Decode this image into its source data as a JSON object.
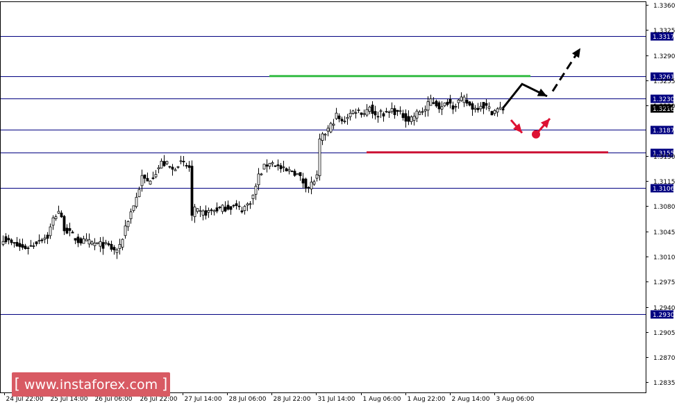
{
  "chart_data": {
    "type": "candlestick",
    "instrument_view": "price chart",
    "y_axis": {
      "range": [
        1.2821,
        1.3364
      ],
      "ticks": [
        "1.3360",
        "1.3325",
        "1.3290",
        "1.3255",
        "1.3220",
        "1.3150",
        "1.3115",
        "1.3080",
        "1.3045",
        "1.3010",
        "1.2975",
        "1.2940",
        "1.2905",
        "1.2870",
        "1.2835"
      ]
    },
    "x_axis": {
      "ticks": [
        "24 Jul 22:00",
        "25 Jul 14:00",
        "26 Jul 06:00",
        "26 Jul 22:00",
        "27 Jul 14:00",
        "28 Jul 06:00",
        "28 Jul 22:00",
        "31 Jul 14:00",
        "1 Aug 06:00",
        "1 Aug 22:00",
        "2 Aug 14:00",
        "3 Aug 06:00"
      ]
    },
    "horizontal_levels": [
      {
        "label": "1.3317",
        "value": 1.3317,
        "color": "#000080"
      },
      {
        "label": "1.3261",
        "value": 1.3261,
        "color": "#000080"
      },
      {
        "label": "1.3230",
        "value": 1.323,
        "color": "#000080"
      },
      {
        "label": "1.3187",
        "value": 1.3187,
        "color": "#000080"
      },
      {
        "label": "1.3155",
        "value": 1.3155,
        "color": "#000080"
      },
      {
        "label": "1.3106",
        "value": 1.3106,
        "color": "#000080"
      },
      {
        "label": "1.2930",
        "value": 1.293,
        "color": "#000080"
      }
    ],
    "current_price": {
      "label": "1.3216",
      "value": 1.3216,
      "color": "#000000"
    },
    "key_levels": [
      {
        "role": "target",
        "value": 1.3261,
        "color": "#33bb44"
      },
      {
        "role": "stop",
        "value": 1.3155,
        "color": "#cc1133"
      }
    ],
    "close_path": [
      [
        0,
        1.3036
      ],
      [
        3,
        1.3028
      ],
      [
        7,
        1.3022
      ],
      [
        10,
        1.3024
      ],
      [
        13,
        1.3034
      ],
      [
        16,
        1.3038
      ],
      [
        18,
        1.3062
      ],
      [
        20,
        1.3074
      ],
      [
        22,
        1.305
      ],
      [
        24,
        1.3042
      ],
      [
        27,
        1.3032
      ],
      [
        30,
        1.303
      ],
      [
        33,
        1.3028
      ],
      [
        36,
        1.3026
      ],
      [
        38,
        1.3024
      ],
      [
        40,
        1.3018
      ],
      [
        42,
        1.3022
      ],
      [
        44,
        1.3052
      ],
      [
        46,
        1.3072
      ],
      [
        48,
        1.3092
      ],
      [
        50,
        1.312
      ],
      [
        52,
        1.3114
      ],
      [
        55,
        1.3128
      ],
      [
        57,
        1.314
      ],
      [
        59,
        1.3138
      ],
      [
        61,
        1.313
      ],
      [
        63,
        1.314
      ],
      [
        65,
        1.3138
      ],
      [
        67,
        1.3134
      ],
      [
        68,
        1.3066
      ],
      [
        69,
        1.3074
      ],
      [
        71,
        1.307
      ],
      [
        74,
        1.3072
      ],
      [
        77,
        1.3076
      ],
      [
        80,
        1.3078
      ],
      [
        83,
        1.308
      ],
      [
        86,
        1.3076
      ],
      [
        88,
        1.3082
      ],
      [
        90,
        1.3094
      ],
      [
        92,
        1.3122
      ],
      [
        94,
        1.3134
      ],
      [
        96,
        1.3142
      ],
      [
        98,
        1.3138
      ],
      [
        100,
        1.3132
      ],
      [
        102,
        1.3128
      ],
      [
        104,
        1.313
      ],
      [
        106,
        1.3124
      ],
      [
        108,
        1.3114
      ],
      [
        110,
        1.3106
      ],
      [
        112,
        1.3116
      ],
      [
        113,
        1.312
      ],
      [
        114,
        1.317
      ],
      [
        116,
        1.3182
      ],
      [
        118,
        1.3192
      ],
      [
        120,
        1.3206
      ],
      [
        122,
        1.3196
      ],
      [
        124,
        1.3206
      ],
      [
        127,
        1.3214
      ],
      [
        130,
        1.321
      ],
      [
        132,
        1.322
      ],
      [
        134,
        1.3204
      ],
      [
        136,
        1.3212
      ],
      [
        138,
        1.3208
      ],
      [
        140,
        1.3214
      ],
      [
        142,
        1.321
      ],
      [
        144,
        1.3206
      ],
      [
        146,
        1.32
      ],
      [
        148,
        1.3206
      ],
      [
        150,
        1.3212
      ],
      [
        152,
        1.3214
      ],
      [
        154,
        1.3228
      ],
      [
        156,
        1.3222
      ],
      [
        158,
        1.3216
      ],
      [
        160,
        1.3226
      ],
      [
        162,
        1.322
      ],
      [
        164,
        1.3226
      ],
      [
        166,
        1.3228
      ],
      [
        168,
        1.322
      ],
      [
        170,
        1.3216
      ],
      [
        172,
        1.3222
      ],
      [
        174,
        1.3218
      ],
      [
        176,
        1.3212
      ],
      [
        178,
        1.3214
      ],
      [
        180,
        1.3216
      ]
    ],
    "forecast_arrows": [
      {
        "scenario": "bullish",
        "color": "#000000",
        "points": [
          [
            180,
            1.3216
          ],
          [
            187,
            1.325
          ],
          [
            196,
            1.3233
          ]
        ],
        "dashed": false
      },
      {
        "scenario": "bullish",
        "color": "#000000",
        "points": [
          [
            198,
            1.324
          ],
          [
            208,
            1.33
          ]
        ],
        "dashed": true
      },
      {
        "scenario": "bearish",
        "color": "#dd1133",
        "points": [
          [
            183,
            1.32
          ],
          [
            187,
            1.3182
          ]
        ],
        "dashed": false
      },
      {
        "scenario": "bearish",
        "color": "#dd1133",
        "points": [
          [
            192,
            1.318
          ],
          [
            197,
            1.3202
          ]
        ],
        "dashed": false
      }
    ],
    "grid": false
  },
  "watermark": {
    "left_bracket": "[",
    "text": "www.instaforex.com",
    "right_bracket": "]"
  }
}
